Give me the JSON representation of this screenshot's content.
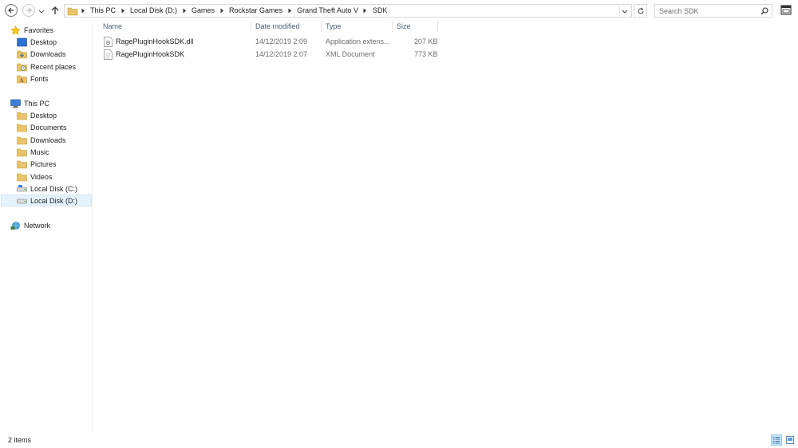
{
  "address_bar": {
    "crumbs": [
      "This PC",
      "Local Disk (D:)",
      "Games",
      "Rockstar Games",
      "Grand Theft Auto V",
      "SDK"
    ]
  },
  "search": {
    "placeholder": "Search SDK"
  },
  "sidebar": {
    "favorites_label": "Favorites",
    "favorites": [
      {
        "label": "Desktop",
        "icon": "desktop-icon"
      },
      {
        "label": "Downloads",
        "icon": "downloads-folder-icon"
      },
      {
        "label": "Recent places",
        "icon": "recent-places-icon"
      },
      {
        "label": "Fonts",
        "icon": "fonts-folder-icon"
      }
    ],
    "thispc_label": "This PC",
    "thispc": [
      {
        "label": "Desktop",
        "icon": "folder-icon"
      },
      {
        "label": "Documents",
        "icon": "folder-icon"
      },
      {
        "label": "Downloads",
        "icon": "folder-icon"
      },
      {
        "label": "Music",
        "icon": "folder-icon"
      },
      {
        "label": "Pictures",
        "icon": "folder-icon"
      },
      {
        "label": "Videos",
        "icon": "folder-icon"
      },
      {
        "label": "Local Disk (C:)",
        "icon": "drive-icon"
      },
      {
        "label": "Local Disk (D:)",
        "icon": "drive-icon",
        "selected": true
      }
    ],
    "network_label": "Network"
  },
  "columns": {
    "name": "Name",
    "date": "Date modified",
    "type": "Type",
    "size": "Size"
  },
  "files": [
    {
      "name": "RagePluginHookSDK.dll",
      "date": "14/12/2019 2:09",
      "type": "Application extens...",
      "size": "207 KB",
      "icon": "dll-file-icon"
    },
    {
      "name": "RagePluginHookSDK",
      "date": "14/12/2019 2:07",
      "type": "XML Document",
      "size": "773 KB",
      "icon": "xml-file-icon"
    }
  ],
  "status": {
    "item_count": "2 items"
  },
  "colors": {
    "selection": "#e5f3ff",
    "header_text": "#4c607a",
    "meta_text": "#6d6d6d"
  }
}
